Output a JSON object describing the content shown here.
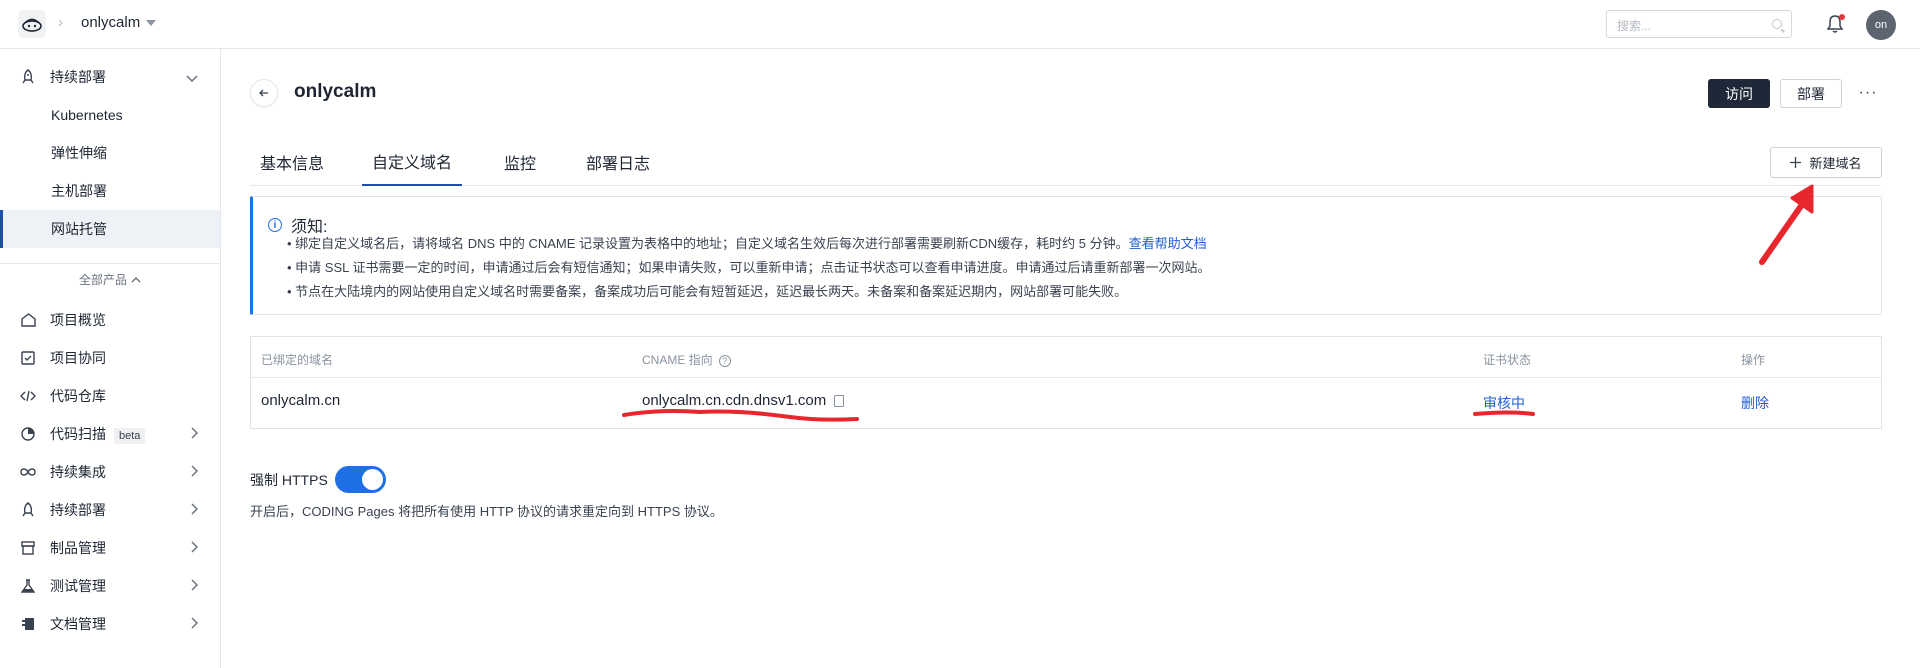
{
  "topbar": {
    "project_name": "onlycalm",
    "search_placeholder": "搜索...",
    "avatar_text": "on"
  },
  "sidebar": {
    "group": {
      "label": "持续部署"
    },
    "sub_items": [
      {
        "label": "Kubernetes"
      },
      {
        "label": "弹性伸缩"
      },
      {
        "label": "主机部署"
      },
      {
        "label": "网站托管"
      }
    ],
    "all_products": "全部产品",
    "items": [
      {
        "label": "项目概览"
      },
      {
        "label": "项目协同"
      },
      {
        "label": "代码仓库"
      },
      {
        "label": "代码扫描",
        "badge": "beta"
      },
      {
        "label": "持续集成"
      },
      {
        "label": "持续部署"
      },
      {
        "label": "制品管理"
      },
      {
        "label": "测试管理"
      },
      {
        "label": "文档管理"
      }
    ]
  },
  "header": {
    "title": "onlycalm",
    "visit_label": "访问",
    "deploy_label": "部署",
    "more_label": "···"
  },
  "tabs": [
    {
      "label": "基本信息"
    },
    {
      "label": "自定义域名"
    },
    {
      "label": "监控"
    },
    {
      "label": "部署日志"
    }
  ],
  "new_domain_label": "新建域名",
  "notice": {
    "title": "须知:",
    "line1": "• 绑定自定义域名后，请将域名 DNS 中的 CNAME 记录设置为表格中的地址；自定义域名生效后每次进行部署需要刷新CDN缓存，耗时约 5 分钟。",
    "line1_link": "查看帮助文档",
    "line2": "• 申请 SSL 证书需要一定的时间，申请通过后会有短信通知；如果申请失败，可以重新申请；点击证书状态可以查看申请进度。申请通过后请重新部署一次网站。",
    "line3": "• 节点在大陆境内的网站使用自定义域名时需要备案，备案成功后可能会有短暂延迟，延迟最长两天。未备案和备案延迟期内，网站部署可能失败。"
  },
  "table": {
    "headers": [
      "已绑定的域名",
      "CNAME 指向",
      "证书状态",
      "操作"
    ],
    "rows": [
      {
        "domain": "onlycalm.cn",
        "cname": "onlycalm.cn.cdn.dnsv1.com",
        "status": "审核中",
        "action": "删除"
      }
    ]
  },
  "https": {
    "label": "强制 HTTPS",
    "enabled": true,
    "description": "开启后，CODING Pages 将把所有使用 HTTP 协议的请求重定向到 HTTPS 协议。"
  },
  "colors": {
    "accent": "#1f6fe5",
    "link": "#1f5fd0",
    "annotation": "#e8262e",
    "dark_button": "#1f2838"
  }
}
